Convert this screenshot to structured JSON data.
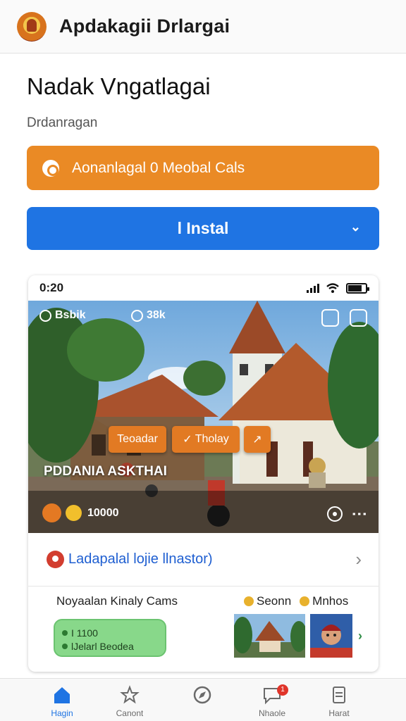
{
  "header": {
    "title": "Apdakagii Drlargai",
    "logo_icon": "temple-logo-icon"
  },
  "page": {
    "title": "Nadak Vngatlagai",
    "subtitle": "Drdanragan"
  },
  "cta_primary": {
    "label": "Aonanlagal 0 Meobal Cals",
    "color": "#ea8a25"
  },
  "install": {
    "label": "l  Instal",
    "color": "#1f74e3"
  },
  "preview": {
    "status_bar": {
      "time": "0:20"
    },
    "overlay": {
      "left_label": "Bsbik",
      "mid_label": "38k",
      "chip_1": "Teoadar",
      "chip_2": "Tholay",
      "location": "PDDANIA ASKTHAI",
      "count": "10000"
    },
    "link": {
      "label": "Ladapalal lojie llnastor)"
    },
    "details": {
      "left_label": "Noyaalan Kinaly Cams",
      "right_label_1": "Seonn",
      "right_label_2": "Mnhos",
      "pill_line_1": "I 1100",
      "pill_line_2": "lJelarl Beodea"
    }
  },
  "bottom_nav": {
    "items": [
      {
        "label": "Hagin",
        "icon": "home-icon"
      },
      {
        "label": "Canont",
        "icon": "star-icon"
      },
      {
        "label": "",
        "icon": "compass-icon"
      },
      {
        "label": "Nhaole",
        "icon": "chat-icon",
        "badge": "1"
      },
      {
        "label": "Harat",
        "icon": "document-icon"
      }
    ]
  }
}
